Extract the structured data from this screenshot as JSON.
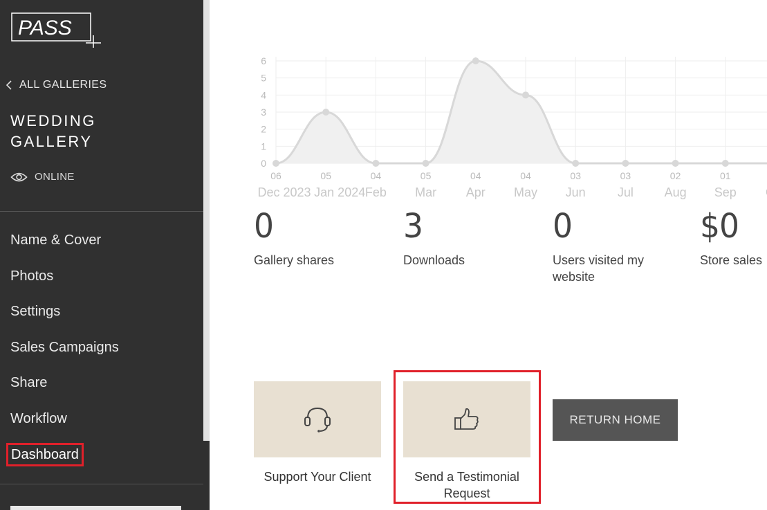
{
  "brand": {
    "logo_text": "PASS"
  },
  "sidebar": {
    "back_label": "ALL GALLERIES",
    "gallery_title": "WEDDING GALLERY",
    "status": "ONLINE",
    "nav": [
      {
        "label": "Name & Cover"
      },
      {
        "label": "Photos"
      },
      {
        "label": "Settings"
      },
      {
        "label": "Sales Campaigns"
      },
      {
        "label": "Share"
      },
      {
        "label": "Workflow"
      },
      {
        "label": "Dashboard",
        "active": true
      }
    ]
  },
  "chart_data": {
    "type": "area",
    "x": [
      "Dec 2023",
      "Jan 2024",
      "Feb",
      "Mar",
      "Apr",
      "May",
      "Jun",
      "Jul",
      "Aug",
      "Sep",
      "Oct"
    ],
    "date_days": [
      "06",
      "05",
      "04",
      "05",
      "04",
      "04",
      "03",
      "03",
      "02",
      "01",
      ""
    ],
    "values": [
      0,
      3,
      0,
      0,
      6,
      4,
      0,
      0,
      0,
      0,
      0
    ],
    "ylim": [
      0,
      6
    ],
    "yticks": [
      0,
      1,
      2,
      3,
      4,
      5,
      6
    ],
    "grid": true,
    "colors": {
      "line": "#d8d8d8",
      "fill": "#f0f0f0",
      "point": "#d8d8d8",
      "grid": "#eeeeee",
      "tick": "#bbbbbb"
    }
  },
  "stats": [
    {
      "value": "0",
      "label": "Gallery shares"
    },
    {
      "value": "3",
      "label": "Downloads"
    },
    {
      "value": "0",
      "label": "Users visited my website"
    },
    {
      "value": "$0",
      "label": "Store sales"
    }
  ],
  "actions": {
    "support_label": "Support Your Client",
    "testimonial_label": "Send a Testimonial Request",
    "return_label": "RETURN HOME"
  },
  "colors": {
    "sidebar": "#303030",
    "card": "#e8e0d2",
    "highlight": "#e0202a",
    "button": "#555555"
  }
}
